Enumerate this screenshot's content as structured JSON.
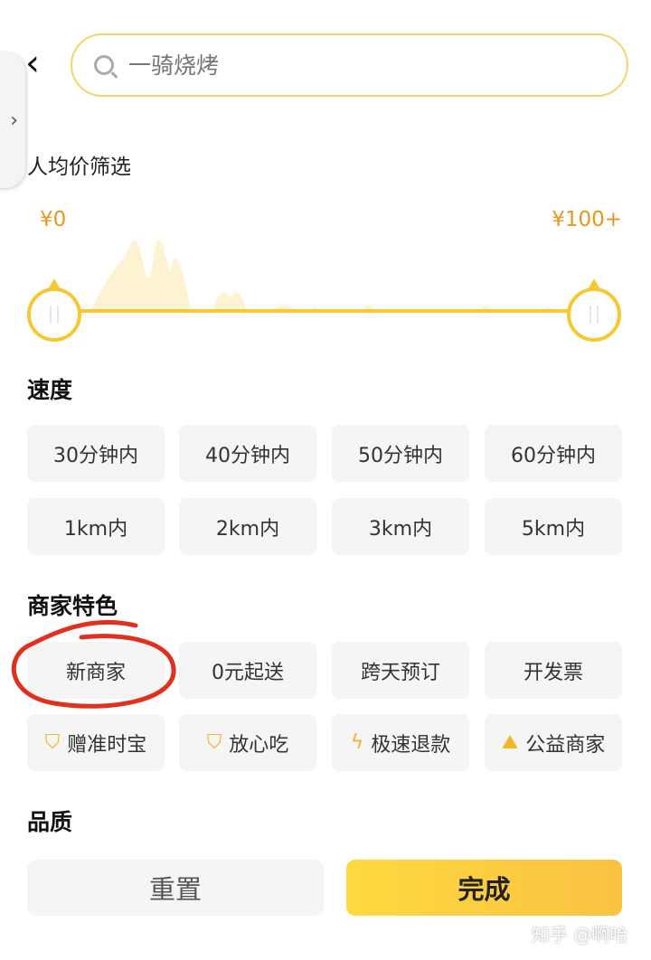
{
  "search": {
    "placeholder": "一骑烧烤"
  },
  "price_filter": {
    "title": "人均价筛选",
    "min_label": "¥0",
    "max_label": "¥100+",
    "range_low_pct": 0,
    "range_high_pct": 100
  },
  "speed": {
    "title": "速度",
    "options": [
      "30分钟内",
      "40分钟内",
      "50分钟内",
      "60分钟内",
      "1km内",
      "2km内",
      "3km内",
      "5km内"
    ]
  },
  "merchant": {
    "title": "商家特色",
    "options": [
      "新商家",
      "0元起送",
      "跨天预订",
      "开发票"
    ],
    "icon_options": [
      {
        "label": "赠准时宝",
        "icon": "shield-check-icon"
      },
      {
        "label": "放心吃",
        "icon": "shield-bao-icon"
      },
      {
        "label": "极速退款",
        "icon": "lightning-icon"
      },
      {
        "label": "公益商家",
        "icon": "mountain-icon"
      }
    ]
  },
  "quality": {
    "title": "品质"
  },
  "footer": {
    "reset": "重置",
    "done": "完成"
  },
  "watermark": "知乎 @啊哈",
  "colors": {
    "accent": "#f6c934",
    "price": "#e8961c",
    "annotation": "#e0301e"
  }
}
